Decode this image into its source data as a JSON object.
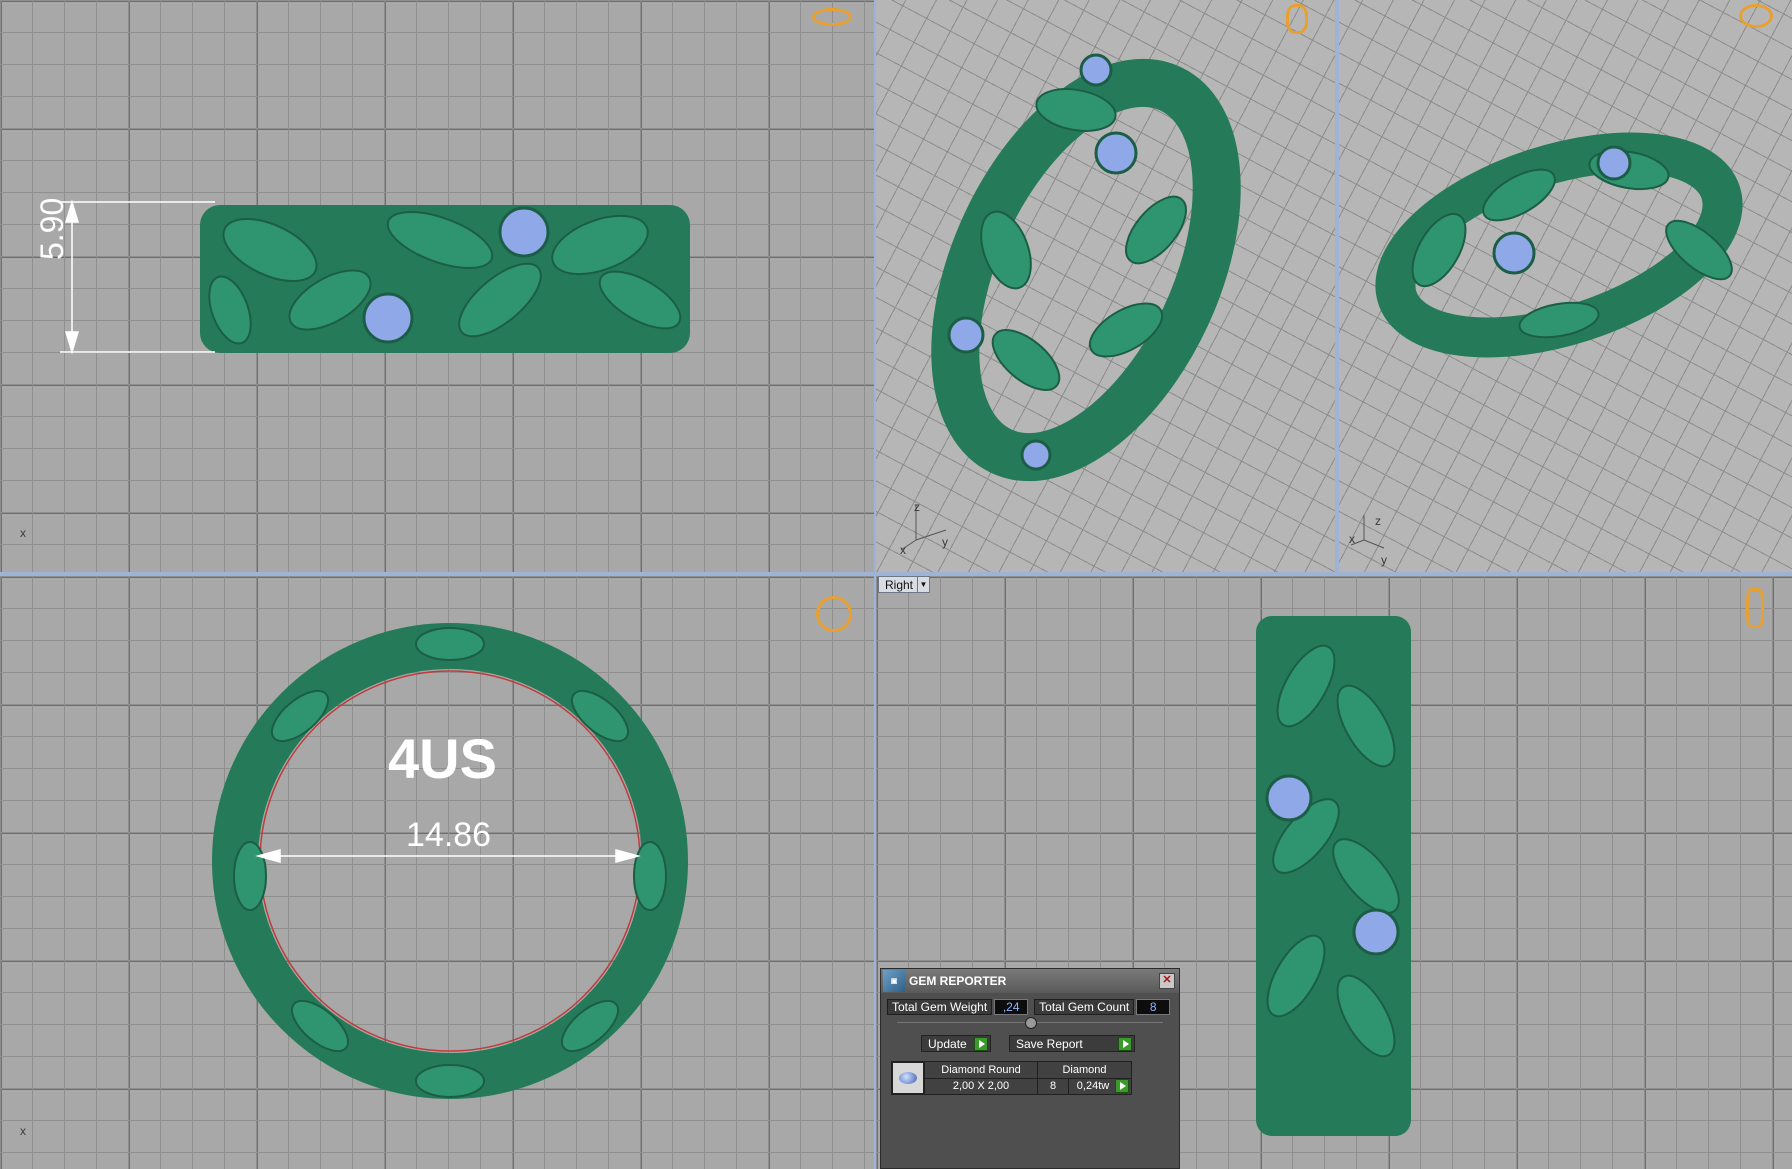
{
  "viewports": {
    "top_left": {
      "dimension_label": "5.90",
      "axis": "x"
    },
    "top_middle": {
      "axes": [
        "z",
        "y",
        "x"
      ]
    },
    "top_right": {
      "axes": [
        "z",
        "y",
        "x"
      ]
    },
    "bottom_left": {
      "size_label": "4US",
      "diameter_label": "14.86",
      "axis": "x"
    },
    "bottom_right": {
      "view_menu_label": "Right"
    }
  },
  "gem_reporter": {
    "title": "GEM REPORTER",
    "total_weight_label": "Total Gem Weight",
    "total_weight_value": ",24",
    "total_count_label": "Total Gem Count",
    "total_count_value": "8",
    "update_label": "Update",
    "save_report_label": "Save Report",
    "table": {
      "headers": [
        "Diamond Round",
        "Diamond"
      ],
      "row": {
        "size": "2,00 X 2,00",
        "count": "8",
        "weight": "0,24tw"
      }
    }
  },
  "colors": {
    "metal": "#2f8a68",
    "gem": "#8fa8e8",
    "dimension": "#ffffff",
    "nav_icon": "#e8a030",
    "viewport_divider": "#9fb3d6"
  }
}
